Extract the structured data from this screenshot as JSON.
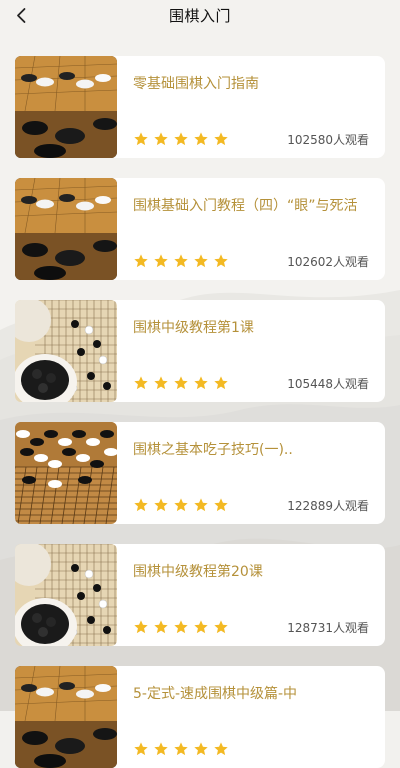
{
  "header": {
    "title": "围棋入门",
    "back_icon": "chevron-left-icon"
  },
  "theme": {
    "accent": "#b5913a",
    "star_color": "#f3b923",
    "card_bg": "#ffffff"
  },
  "courses": [
    {
      "title": "零基础围棋入门指南",
      "rating": 5,
      "views": "102580人观看",
      "thumb": "board-angle"
    },
    {
      "title": "围棋基础入门教程（四）“眼”与死活",
      "rating": 5,
      "views": "102602人观看",
      "thumb": "board-angle"
    },
    {
      "title": "围棋中级教程第1课",
      "rating": 5,
      "views": "105448人观看",
      "thumb": "bowl-board"
    },
    {
      "title": "围棋之基本吃子技巧(一)..",
      "rating": 5,
      "views": "122889人观看",
      "thumb": "board-stones"
    },
    {
      "title": "围棋中级教程第20课",
      "rating": 5,
      "views": "128731人观看",
      "thumb": "bowl-board"
    },
    {
      "title": "5-定式-速成围棋中级篇-中",
      "rating": 5,
      "views": "",
      "thumb": "board-angle"
    }
  ]
}
